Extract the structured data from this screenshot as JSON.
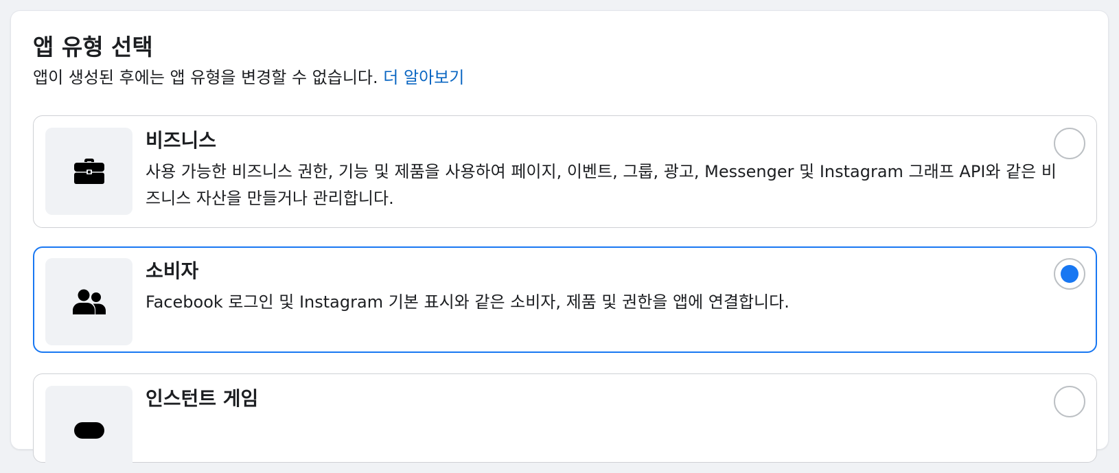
{
  "header": {
    "title": "앱 유형 선택",
    "subtitle": "앱이 생성된 후에는 앱 유형을 변경할 수 없습니다.",
    "learn_more": "더 알아보기"
  },
  "options": [
    {
      "name": "비즈니스",
      "description": "사용 가능한 비즈니스 권한, 기능 및 제품을 사용하여 페이지, 이벤트, 그룹, 광고, Messenger 및 Instagram 그래프 API와 같은 비즈니스 자산을 만들거나 관리합니다.",
      "icon": "briefcase-icon",
      "selected": false
    },
    {
      "name": "소비자",
      "description": "Facebook 로그인 및 Instagram 기본 표시와 같은 소비자, 제품 및 권한을 앱에 연결합니다.",
      "icon": "people-icon",
      "selected": true
    },
    {
      "name": "인스턴트 게임",
      "description": "",
      "icon": "game-icon",
      "selected": false
    }
  ],
  "colors": {
    "accent": "#1877f2",
    "link": "#0a66c2",
    "border": "#ced0d4",
    "tile": "#f0f2f5"
  }
}
